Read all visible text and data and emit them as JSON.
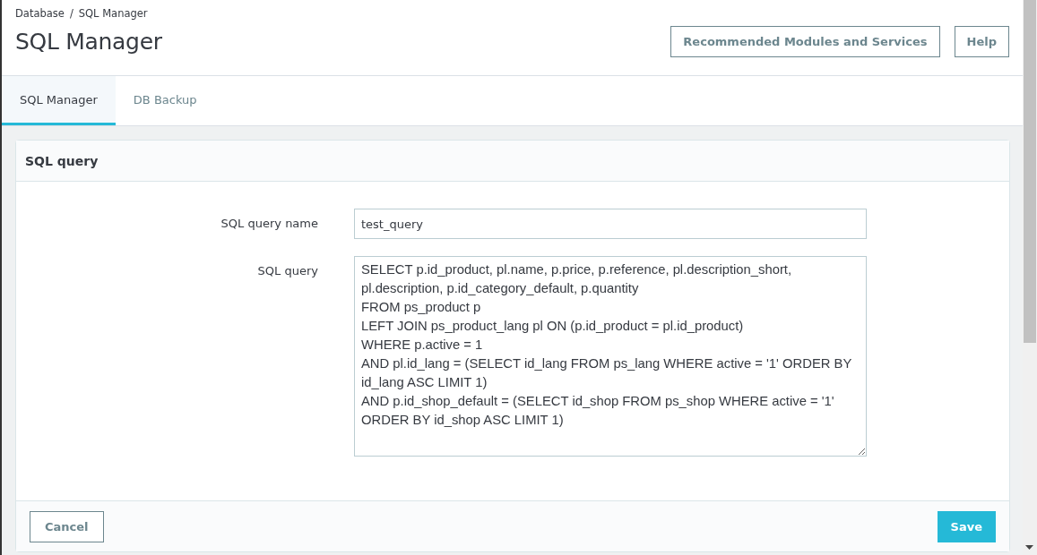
{
  "breadcrumb": [
    "Database",
    "SQL Manager"
  ],
  "breadcrumb_separator": "/",
  "title": "SQL Manager",
  "header_buttons": [
    "Recommended Modules and Services",
    "Help"
  ],
  "tabs": [
    {
      "label": "SQL Manager",
      "selected": true
    },
    {
      "label": "DB Backup",
      "selected": false
    }
  ],
  "panel": {
    "title": "SQL query",
    "fields": [
      {
        "kind": "input",
        "label": "SQL query name",
        "value": "test_query"
      },
      {
        "kind": "textarea",
        "label": "SQL query",
        "value": "SELECT p.id_product, pl.name, p.price, p.reference, pl.description_short, pl.description, p.id_category_default, p.quantity\nFROM ps_product p\nLEFT JOIN ps_product_lang pl ON (p.id_product = pl.id_product)\nWHERE p.active = 1\nAND pl.id_lang = (SELECT id_lang FROM ps_lang WHERE active = '1' ORDER BY id_lang ASC LIMIT 1)\nAND p.id_shop_default = (SELECT id_shop FROM ps_shop WHERE active = '1' ORDER BY id_shop ASC LIMIT 1)"
      }
    ],
    "cancel": "Cancel",
    "save": "Save"
  }
}
